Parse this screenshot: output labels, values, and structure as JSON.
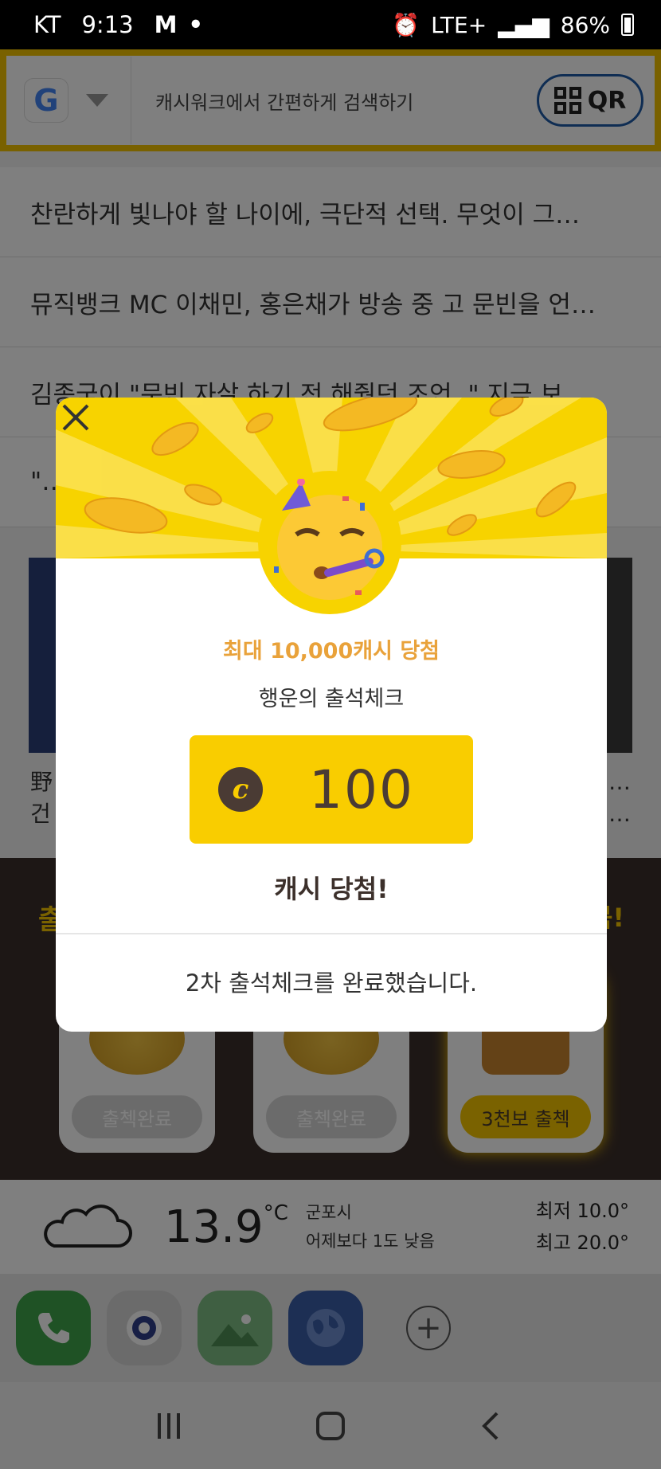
{
  "status_bar": {
    "carrier": "KT",
    "time": "9:13",
    "notification_icons": "M",
    "network": "LTE+",
    "battery": "86%"
  },
  "search": {
    "logo": "G",
    "placeholder": "캐시워크에서 간편하게 검색하기",
    "qr_label": "QR"
  },
  "news": [
    "찬란하게 빛나야 할 나이에, 극단적 선택. 무엇이 그…",
    "뮤직뱅크 MC 이채민, 홍은채가 방송 중 고 문빈을 언…",
    "김종국이 \"문빈 자살 하기 전 해줬던 조언..\" 지금 보…",
    "\"…"
  ],
  "thumb_captions": {
    "left_line1": "野",
    "left_line2": "건",
    "right_line1": "…",
    "right_line2": "…"
  },
  "attendance": {
    "title": "출",
    "title_suffix": "뭄!",
    "cards": [
      {
        "button": "출첵완료",
        "active": false
      },
      {
        "button": "출첵완료",
        "active": false
      },
      {
        "button": "3천보 출첵",
        "active": true
      }
    ]
  },
  "weather": {
    "temperature": "13.9",
    "unit": "°C",
    "location": "군포시",
    "compare": "어제보다 1도 낮음",
    "low": "최저 10.0°",
    "high": "최고 20.0°"
  },
  "modal": {
    "promo": "최대 10,000캐시 당첨",
    "subtitle": "행운의 출석체크",
    "coin_symbol": "c",
    "cash_amount": "100",
    "cash_won": "캐시 당첨!",
    "message": "2차 출석체크를 완료했습니다."
  },
  "dock": {
    "add_label": "+"
  },
  "colors": {
    "accent_yellow": "#f7d300",
    "brand_brown": "#4a3b34",
    "promo_orange": "#e9a23a"
  }
}
